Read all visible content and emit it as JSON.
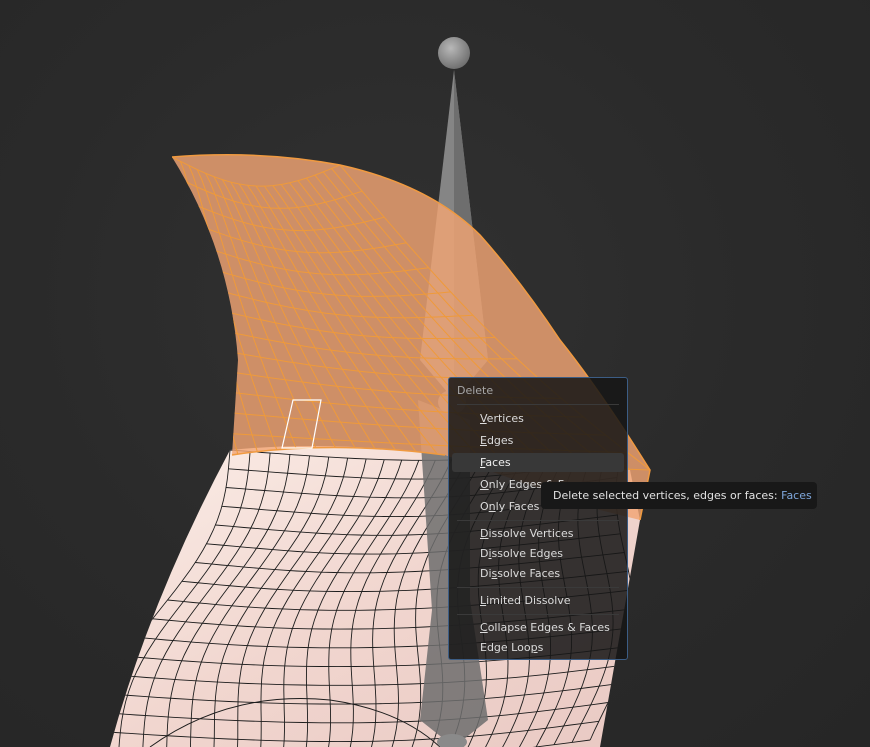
{
  "menu": {
    "title": "Delete",
    "items": [
      {
        "u": "V",
        "rest": "ertices"
      },
      {
        "u": "E",
        "rest": "dges"
      },
      {
        "u": "F",
        "rest": "aces",
        "active": true
      },
      {
        "u": "O",
        "rest": "nly Edges & Faces"
      },
      {
        "pre": "O",
        "u": "n",
        "rest": "ly Faces"
      },
      {
        "u": "D",
        "rest": "issolve Vertices"
      },
      {
        "pre": "D",
        "u": "i",
        "rest": "ssolve Edges"
      },
      {
        "pre": "Di",
        "u": "s",
        "rest": "solve Faces"
      },
      {
        "u": "L",
        "rest": "imited Dissolve"
      },
      {
        "u": "C",
        "rest": "ollapse Edges & Faces"
      },
      {
        "pre": "Edge Loo",
        "u": "p",
        "rest": "s"
      }
    ]
  },
  "tooltip": {
    "text": "Delete selected vertices, edges or faces: ",
    "highlight": "Faces"
  },
  "colors": {
    "selection": "#f0a050",
    "mesh_wire": "#1b1b1b",
    "accent": "#7fa7dc"
  }
}
